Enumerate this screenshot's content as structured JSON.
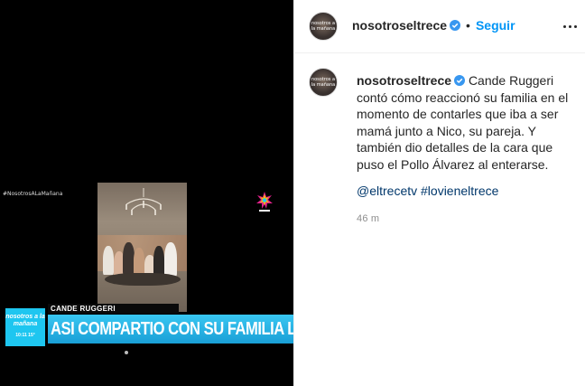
{
  "media": {
    "overlay_hashtag": "#NosotrosALaMañana",
    "lower_third_name": "CANDE RUGGERI",
    "lower_third_headline": "ASI COMPARTIO CON SU FAMILIA LA NOTICIA",
    "show_logo_text": "nosotros a la mañana",
    "show_logo_sub": "10:11  15°"
  },
  "header": {
    "username": "nosotroseltrece",
    "separator": "•",
    "follow_label": "Seguir",
    "avatar_text": "nosotros a la mañana"
  },
  "post": {
    "username": "nosotroseltrece",
    "caption": "Cande Ruggeri contó cómo reaccionó su familia en el momento de contarles que iba a ser mamá junto a Nico, su pareja. Y también dio detalles de la cara que puso el Pollo Álvarez al enterarse.",
    "tags": [
      "@eltrecetv",
      "#lovieneltrece"
    ],
    "time": "46 m"
  },
  "colors": {
    "link_blue": "#0095f6",
    "tag_blue": "#00376b",
    "text": "#262626",
    "muted": "#8e8e8e",
    "lower_bar": "#1fa8e0"
  }
}
